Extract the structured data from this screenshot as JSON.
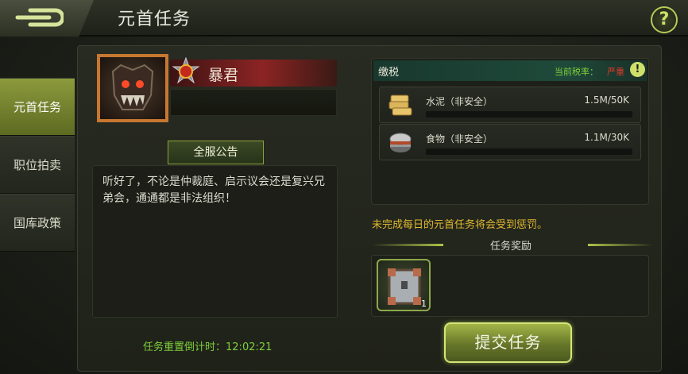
{
  "header": {
    "title": "元首任务",
    "back_icon": "back-arrow-icon",
    "help_label": "?"
  },
  "sidebar": {
    "items": [
      {
        "label": "元首任务",
        "active": true
      },
      {
        "label": "职位拍卖",
        "active": false
      },
      {
        "label": "国库政策",
        "active": false
      }
    ]
  },
  "boss": {
    "name": "暴君",
    "portrait_icon": "tyrant-portrait-icon",
    "rank_icon": "rank-badge-icon"
  },
  "announcement": {
    "tab_label": "全服公告",
    "text": "听好了，不论是仲裁庭、启示议会还是复兴兄弟会，通通都是非法组织！"
  },
  "countdown": {
    "label": "任务重置倒计时：",
    "value": "12:02:21"
  },
  "tax": {
    "title": "缴税",
    "rate_label": "当前税率：",
    "rate_value": "严重",
    "rows": [
      {
        "icon": "cement-icon",
        "name": "水泥（非安全）",
        "amount": "1.5M/50K"
      },
      {
        "icon": "food-can-icon",
        "name": "食物（非安全）",
        "amount": "1.1M/30K"
      }
    ]
  },
  "penalty_text": "未完成每日的元首任务将会受到惩罚。",
  "reward": {
    "title": "任务奖励",
    "items": [
      {
        "icon": "supply-crate-icon",
        "count": "1"
      }
    ]
  },
  "submit_label": "提交任务",
  "colors": {
    "accent_green": "#7ed03a",
    "penalty_gold": "#e0b830",
    "rate_red": "#e03a2a",
    "active_tab": "#8c9a3c"
  }
}
